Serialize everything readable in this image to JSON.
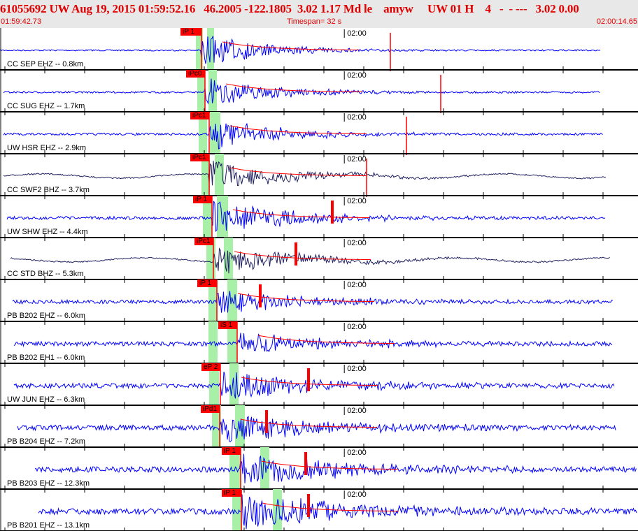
{
  "header": {
    "title": "61055692 UW Aug 19, 2015 01:59:52.16   46.2005 -122.1805  3.02 1.17 Md le    amyw     UW 01 H    4   -  - ---   3.02 0.00",
    "start_time": "01:59:42.73",
    "timespan": "Timespan=  32 s",
    "end_time": "02:00:14.65"
  },
  "time_label": "02:00",
  "colors": {
    "header_text": "#e00000",
    "trace_blue": "#0000ff",
    "trace_navy": "#202060",
    "pick": "#ff0000",
    "window": "#a8f0a8",
    "header_bg": "#e8e8e8"
  },
  "traces": [
    {
      "label": "CC SEP EHZ -- 0.8km",
      "pick": "iP 1",
      "color": "blue"
    },
    {
      "label": "CC SUG EHZ -- 1.7km",
      "pick": "iPc0",
      "color": "blue"
    },
    {
      "label": "UW HSR EHZ -- 2.9km",
      "pick": "iPc1",
      "color": "blue"
    },
    {
      "label": "CC SWF2 BHZ -- 3.7km",
      "pick": "iPc1",
      "color": "navy"
    },
    {
      "label": "UW SHW EHZ -- 4.4km",
      "pick": "iP 1",
      "color": "blue"
    },
    {
      "label": "CC STD BHZ -- 5.3km",
      "pick": "iPc1",
      "color": "navy"
    },
    {
      "label": "PB B202 EHZ -- 6.0km",
      "pick": "iP 1",
      "color": "blue"
    },
    {
      "label": "PB B202 EH1 -- 6.0km",
      "pick": "iS 1",
      "color": "blue"
    },
    {
      "label": "UW JUN EHZ -- 6.3km",
      "pick": "eP 2",
      "color": "blue"
    },
    {
      "label": "PB B204 EHZ -- 7.2km",
      "pick": "iPd1",
      "color": "blue"
    },
    {
      "label": "PB B203 EHZ -- 12.3km",
      "pick": "iP 1",
      "color": "blue"
    },
    {
      "label": "PB B201 EHZ -- 13.1km",
      "pick": "iP 1",
      "color": "blue"
    }
  ]
}
